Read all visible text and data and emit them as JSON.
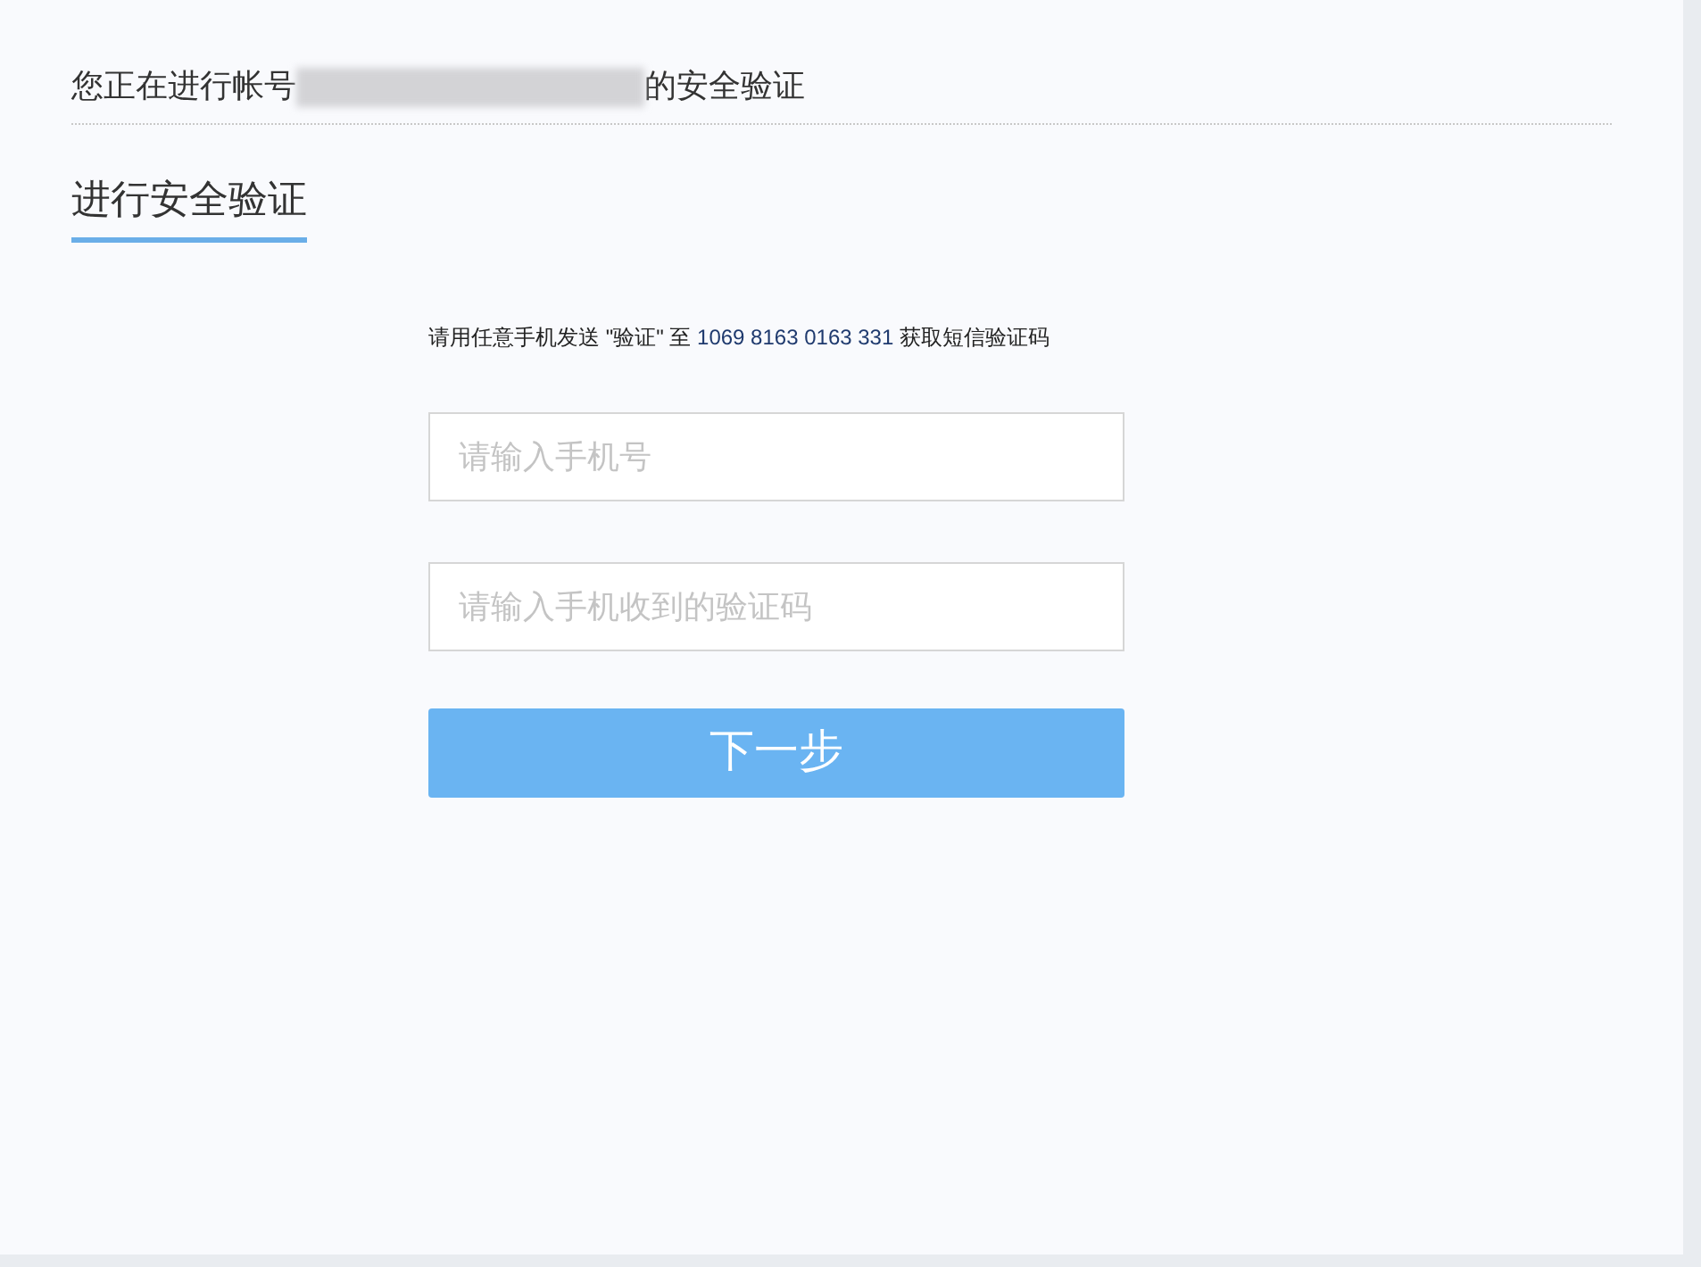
{
  "header": {
    "text_before": "您正在进行帐号",
    "account_redacted": true,
    "text_after": "的安全验证"
  },
  "tabs": [
    {
      "label": "进行安全验证",
      "selected": true
    }
  ],
  "instruction": {
    "before": "请用任意手机发送 \"验证\" 至 ",
    "number": "1069 8163 0163 331",
    "after": " 获取短信验证码"
  },
  "fields": [
    {
      "placeholder": "请输入手机号"
    },
    {
      "placeholder": "请输入手机收到的验证码"
    }
  ],
  "submit_button": {
    "label": "下一步"
  }
}
